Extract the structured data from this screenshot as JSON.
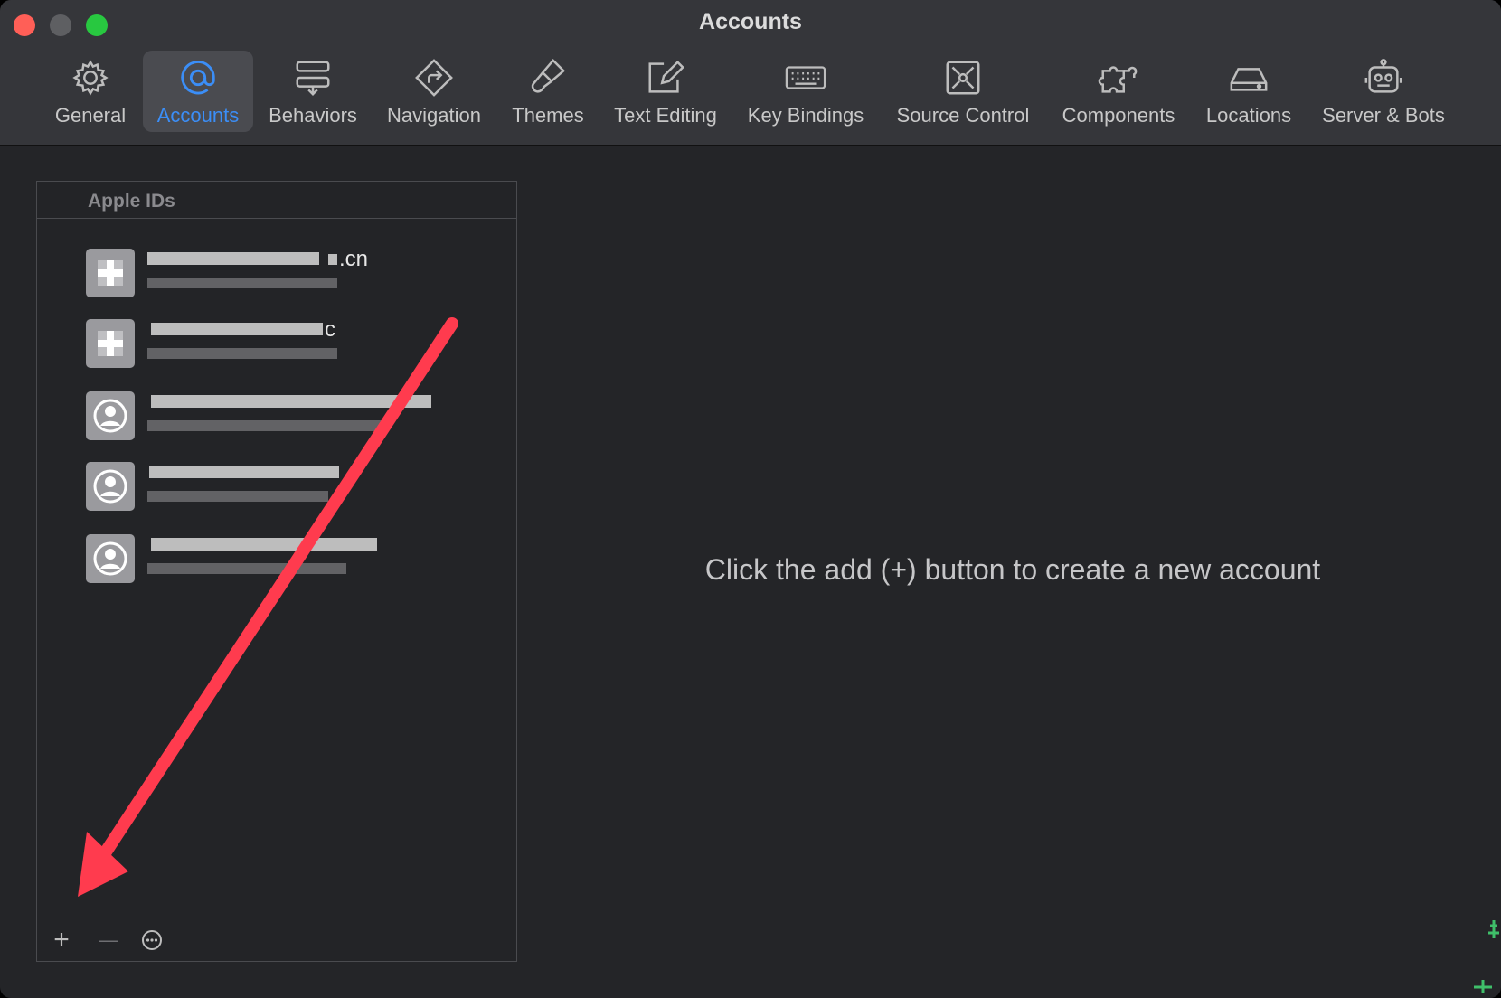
{
  "window": {
    "title": "Accounts"
  },
  "toolbar": {
    "items": [
      {
        "label": "General",
        "icon": "gear-icon"
      },
      {
        "label": "Accounts",
        "icon": "at-sign-icon",
        "active": true
      },
      {
        "label": "Behaviors",
        "icon": "behaviors-icon"
      },
      {
        "label": "Navigation",
        "icon": "navigation-icon"
      },
      {
        "label": "Themes",
        "icon": "paintbrush-icon"
      },
      {
        "label": "Text Editing",
        "icon": "pencil-square-icon"
      },
      {
        "label": "Key Bindings",
        "icon": "keyboard-icon"
      },
      {
        "label": "Source Control",
        "icon": "source-control-icon"
      },
      {
        "label": "Components",
        "icon": "puzzle-icon"
      },
      {
        "label": "Locations",
        "icon": "drive-icon"
      },
      {
        "label": "Server & Bots",
        "icon": "robot-icon"
      }
    ],
    "active_color": "#3b8ef7"
  },
  "accounts_panel": {
    "header": "Apple IDs",
    "accounts": [
      {
        "name_visible_suffix": ".cn"
      },
      {
        "name_visible_suffix": "c"
      },
      {
        "name_visible_suffix": ""
      },
      {
        "name_visible_suffix": ""
      },
      {
        "name_visible_suffix": ""
      }
    ],
    "footer": {
      "add_label": "+",
      "remove_label": "—",
      "more_icon": "ellipsis-circle-icon"
    }
  },
  "main": {
    "empty_message": "Click the add (+) button to create a new account"
  },
  "annotation": {
    "arrow_color": "#ff3b4e"
  }
}
